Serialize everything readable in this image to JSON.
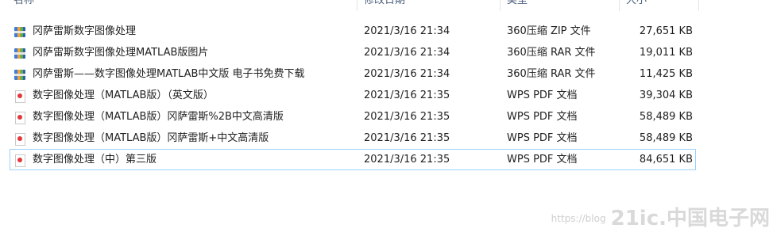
{
  "header": {
    "name": "名称",
    "date": "修改日期",
    "type": "类型",
    "size": "大小"
  },
  "files": [
    {
      "name": "冈萨雷斯数字图像处理",
      "date": "2021/3/16 21:34",
      "type": "360压缩 ZIP 文件",
      "size": "27,651 KB",
      "icon": "archive-icon"
    },
    {
      "name": "冈萨雷斯数字图像处理MATLAB版图片",
      "date": "2021/3/16 21:34",
      "type": "360压缩 RAR 文件",
      "size": "19,011 KB",
      "icon": "archive-icon"
    },
    {
      "name": "冈萨雷斯——数字图像处理MATLAB中文版 电子书免费下载",
      "date": "2021/3/16 21:34",
      "type": "360压缩 RAR 文件",
      "size": "11,425 KB",
      "icon": "archive-icon"
    },
    {
      "name": "数字图像处理（MATLAB版）（英文版）",
      "date": "2021/3/16 21:35",
      "type": "WPS PDF 文档",
      "size": "39,304 KB",
      "icon": "pdf-icon"
    },
    {
      "name": "数字图像处理（MATLAB版）冈萨雷斯%2B中文高清版",
      "date": "2021/3/16 21:35",
      "type": "WPS PDF 文档",
      "size": "58,489 KB",
      "icon": "pdf-icon"
    },
    {
      "name": "数字图像处理（MATLAB版）冈萨雷斯+中文高清版",
      "date": "2021/3/16 21:35",
      "type": "WPS PDF 文档",
      "size": "58,489 KB",
      "icon": "pdf-icon"
    },
    {
      "name": "数字图像处理（中）第三版",
      "date": "2021/3/16 21:35",
      "type": "WPS PDF 文档",
      "size": "84,651 KB",
      "icon": "pdf-icon"
    }
  ],
  "watermark": {
    "text": "https://blog",
    "logo": "21ic.中国电子网"
  }
}
